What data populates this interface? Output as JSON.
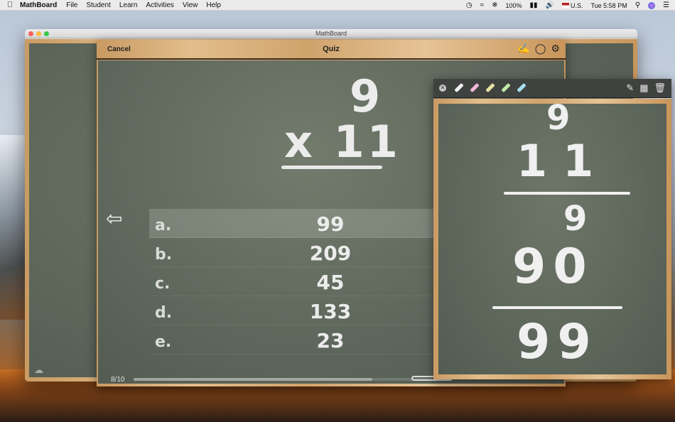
{
  "menubar": {
    "apple": "",
    "app_name": "MathBoard",
    "menus": [
      "File",
      "Student",
      "Learn",
      "Activities",
      "View",
      "Help"
    ],
    "battery": "100%",
    "input_source": "U.S.",
    "clock": "Tue 5:58 PM"
  },
  "window": {
    "title": "MathBoard"
  },
  "quiz": {
    "cancel_label": "Cancel",
    "title": "Quiz",
    "problem": {
      "top": "9",
      "operator_line": "x 11"
    },
    "answers": [
      {
        "letter": "a.",
        "value": "99",
        "selected": true
      },
      {
        "letter": "b.",
        "value": "209",
        "selected": false
      },
      {
        "letter": "c.",
        "value": "45",
        "selected": false
      },
      {
        "letter": "d.",
        "value": "133",
        "selected": false
      },
      {
        "letter": "e.",
        "value": "23",
        "selected": false
      }
    ],
    "progress_label": "8/10",
    "progress_fraction": 0.8
  },
  "scratchpad": {
    "chalk_colors": [
      "#f2f2f2",
      "#f4b6d8",
      "#e8e2a4",
      "#bfe8a8",
      "#a6dff0"
    ],
    "handwriting": {
      "line1": "9",
      "line2": "11",
      "line3": "9",
      "line4": "90",
      "line5": "99"
    }
  },
  "icons": {
    "apple": "apple-icon",
    "signature": "signature-icon",
    "hint": "lightbulb-icon",
    "settings": "gear-icon",
    "back": "back-arrow-icon",
    "cloud": "cloud-icon"
  }
}
